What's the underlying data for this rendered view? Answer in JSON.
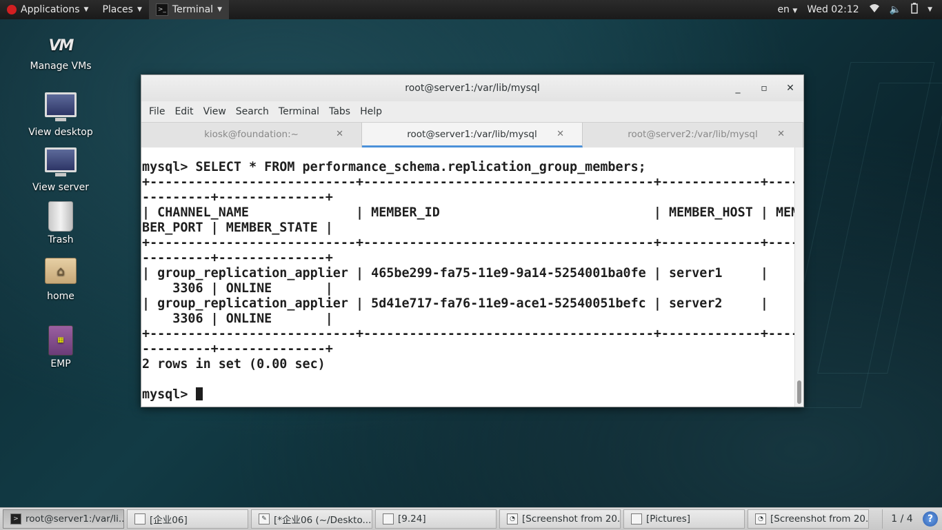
{
  "top_panel": {
    "applications_label": "Applications",
    "places_label": "Places",
    "terminal_label": "Terminal",
    "language": "en",
    "clock": "Wed 02:12"
  },
  "desktop_icons": [
    {
      "label": "Manage VMs",
      "icon": "vm-manager-icon"
    },
    {
      "label": "View desktop",
      "icon": "monitor-icon"
    },
    {
      "label": "View server",
      "icon": "monitor-icon"
    },
    {
      "label": "Trash",
      "icon": "trash-icon"
    },
    {
      "label": "home",
      "icon": "home-folder-icon"
    },
    {
      "label": "EMP",
      "icon": "emp-app-icon"
    }
  ],
  "window": {
    "title": "root@server1:/var/lib/mysql",
    "menu": [
      "File",
      "Edit",
      "View",
      "Search",
      "Terminal",
      "Tabs",
      "Help"
    ],
    "tabs": [
      {
        "label": "kiosk@foundation:~",
        "active": false
      },
      {
        "label": "root@server1:/var/lib/mysql",
        "active": true
      },
      {
        "label": "root@server2:/var/lib/mysql",
        "active": false
      }
    ],
    "terminal_lines": [
      "mysql> SELECT * FROM performance_schema.replication_group_members;",
      "+---------------------------+--------------------------------------+-------------+----",
      "---------+--------------+",
      "| CHANNEL_NAME              | MEMBER_ID                            | MEMBER_HOST | MEM",
      "BER_PORT | MEMBER_STATE |",
      "+---------------------------+--------------------------------------+-------------+----",
      "---------+--------------+",
      "| group_replication_applier | 465be299-fa75-11e9-9a14-5254001ba0fe | server1     |",
      "    3306 | ONLINE       |",
      "| group_replication_applier | 5d41e717-fa76-11e9-ace1-52540051befc | server2     |",
      "    3306 | ONLINE       |",
      "+---------------------------+--------------------------------------+-------------+----",
      "---------+--------------+",
      "2 rows in set (0.00 sec)",
      ""
    ],
    "prompt": "mysql> "
  },
  "taskbar": {
    "tasks": [
      {
        "label": "root@server1:/var/li...",
        "icon": "terminal-icon",
        "active": true
      },
      {
        "label": "[企业06]",
        "icon": "document-icon",
        "active": false
      },
      {
        "label": "[*企业06 (~/Deskto...",
        "icon": "text-editor-icon",
        "active": false
      },
      {
        "label": "[9.24]",
        "icon": "document-icon",
        "active": false
      },
      {
        "label": "[Screenshot from 20...",
        "icon": "image-viewer-icon",
        "active": false
      },
      {
        "label": "[Pictures]",
        "icon": "folder-icon",
        "active": false
      },
      {
        "label": "[Screenshot from 20...",
        "icon": "image-viewer-icon",
        "active": false
      }
    ],
    "workspace": "1 / 4"
  }
}
